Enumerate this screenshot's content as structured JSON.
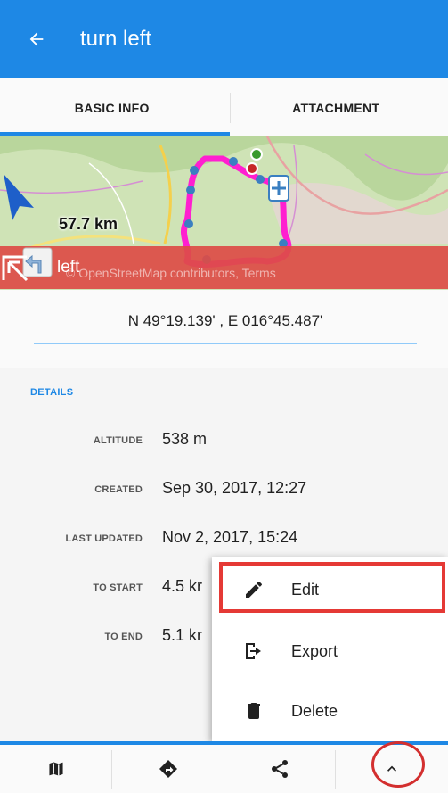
{
  "appbar": {
    "title": "turn left"
  },
  "tabs": [
    {
      "label": "BASIC INFO"
    },
    {
      "label": "ATTACHMENT"
    }
  ],
  "map": {
    "distance": "57.7 km",
    "waypoint_name": "turn left",
    "attribution": "© OpenStreetMap contributors, Terms"
  },
  "coordinates": "N 49°19.139' , E 016°45.487'",
  "details": {
    "heading": "DETAILS",
    "rows": [
      {
        "label": "ALTITUDE",
        "value": "538 m"
      },
      {
        "label": "CREATED",
        "value": "Sep 30, 2017, 12:27"
      },
      {
        "label": "LAST UPDATED",
        "value": "Nov 2, 2017, 15:24"
      },
      {
        "label": "TO START",
        "value": "4.5 kr"
      },
      {
        "label": "TO END",
        "value": "5.1 kr"
      }
    ]
  },
  "menu": {
    "items": [
      {
        "label": "Edit",
        "icon": "pencil-icon"
      },
      {
        "label": "Export",
        "icon": "export-icon"
      },
      {
        "label": "Delete",
        "icon": "trash-icon"
      }
    ]
  },
  "bottombar": {
    "items": [
      {
        "icon": "map-icon"
      },
      {
        "icon": "navigate-icon"
      },
      {
        "icon": "share-icon"
      },
      {
        "icon": "chevron-up-icon"
      }
    ]
  },
  "colors": {
    "primary": "#1e88e5",
    "banner": "#dd4c46",
    "highlight": "#e53935",
    "track": "#ff1fd0"
  }
}
